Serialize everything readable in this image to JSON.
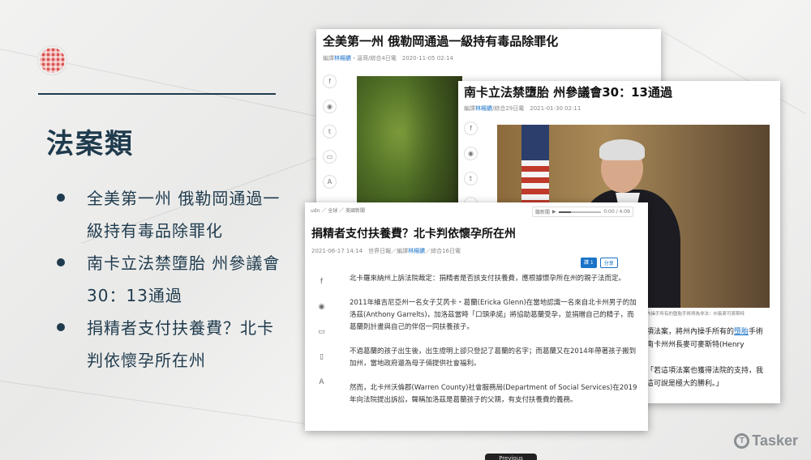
{
  "slide": {
    "title": "法案類",
    "bullets": [
      {
        "line1": "全美第一州 俄勒岡通過一",
        "line2": "級持有毒品除罪化"
      },
      {
        "line1": "南卡立法禁墮胎 州參議會",
        "line2": "30：13通過"
      },
      {
        "line1": "捐精者支付扶養費？北卡",
        "line2": "判依懷孕所在州"
      }
    ]
  },
  "article1": {
    "title": "全美第一州 俄勒岡通過一級持有毒品除罪化",
    "author": "林楊鑣",
    "meta_pre": "編譯",
    "meta_post": "・溫哥/綜合4日電　2020-11-05 02:14"
  },
  "article2": {
    "title": "南卡立法禁墮胎 州參議會30：13通過",
    "author": "林楊鑣",
    "meta_pre": "編譯",
    "meta_post": "/綜合29日電　2021-01-30 02:11",
    "caption": "內操手所有的墮胎手術得為非法：州長麥可麥斯特",
    "text_a": "項法案，將州內操手所有的",
    "text_link": "墮胎",
    "text_b": "手術",
    "text_c": "南卡州州長麥可麥斯特(Henry",
    "text_d": "「若這項法案也獲得法院的支持，我",
    "text_e": "這可說是極大的勝利。」"
  },
  "article3": {
    "breadcrumb": "udn ／ 全球 ／ 美國新聞",
    "audio_label": "聽新聞",
    "audio_time": "0:00 / 4:09",
    "title": "捐精者支付扶養費？北卡判依懷孕所在州",
    "meta_pre": "2021-06-17 14:14　世界日報／編譯",
    "author": "林楊鑣",
    "meta_post": "／綜合16日電",
    "share_like": "讚 1",
    "share_btn": "分享",
    "paragraphs": [
      "北卡羅來納州上訴法院裁定：捐精者是否該支付扶養費，應根據懷孕所在州的親子法而定。",
      "2011年維吉尼亞州一名女子艾芮卡・葛蘭(Ericka Glenn)在當地認識一名來自北卡州男子的加洛茲(Anthony Garrelts)，加洛茲當時「口頭承諾」將協助葛蘭受孕，並捐贈自己的精子，而葛蘭則計畫與自己的伴侶一同扶養孩子。",
      "不過葛蘭的孩子出生後，出生證明上卻只登記了葛蘭的名字；而葛蘭又在2014年帶著孩子搬到加州，當地政府還為母子倆提供社會福利。",
      "然而，北卡州沃倫郡(Warren County)社會服務局(Department of Social Services)在2019年向法院提出訴訟，聲稱加洛茲是葛蘭孩子的父親，有支付扶養費的義務。"
    ]
  },
  "watermark": "Tasker",
  "peek_label": "Previous"
}
